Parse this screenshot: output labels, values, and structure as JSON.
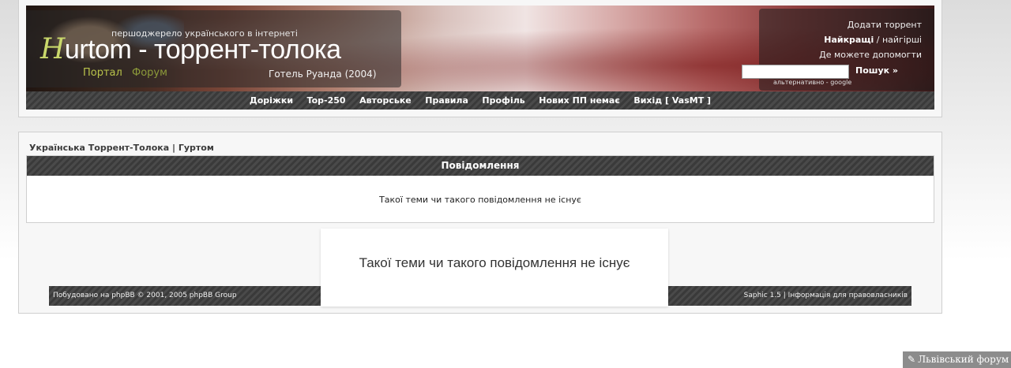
{
  "header": {
    "tagline": "першоджерело українського в інтернеті",
    "logo_initial": "H",
    "logo_rest": "urtom - торрент-толока",
    "portal_link": "Портал",
    "forum_link": "Форум",
    "movie_title": "Готель Руанда (2004)",
    "right_links": {
      "add_torrent": "Додати торрент",
      "best": "Найкращі",
      "worst": " / найгірші",
      "help": "Де можете допомогти"
    },
    "search": {
      "value": "",
      "button_label": "Пошук »",
      "alt_text": "альтернативно - google"
    }
  },
  "nav": {
    "items": [
      "Доріжки",
      "Top-250",
      "Авторське",
      "Правила",
      "Профіль",
      "Нових ПП немає",
      "Вихід [ VasMT ]"
    ]
  },
  "content": {
    "breadcrumb": "Українська Торрент-Толока | Гуртом",
    "message_header": "Повідомлення",
    "message_text": "Такої теми чи такого повідомлення не існує"
  },
  "footer": {
    "left": "Побудовано на phpBB © 2001, 2005 phpBB Group",
    "right_prefix": "Saphic 1.5 | ",
    "right_link": "Інформація для правовласників"
  },
  "popup": {
    "text": "Такої теми чи такого повідомлення не існує"
  },
  "badge": {
    "icon": "scroll-icon",
    "label": "Львівський форум"
  },
  "colors": {
    "nav_bg": "#444444",
    "logo_accent": "#c9d86b",
    "portal_link": "#b8c24a"
  }
}
